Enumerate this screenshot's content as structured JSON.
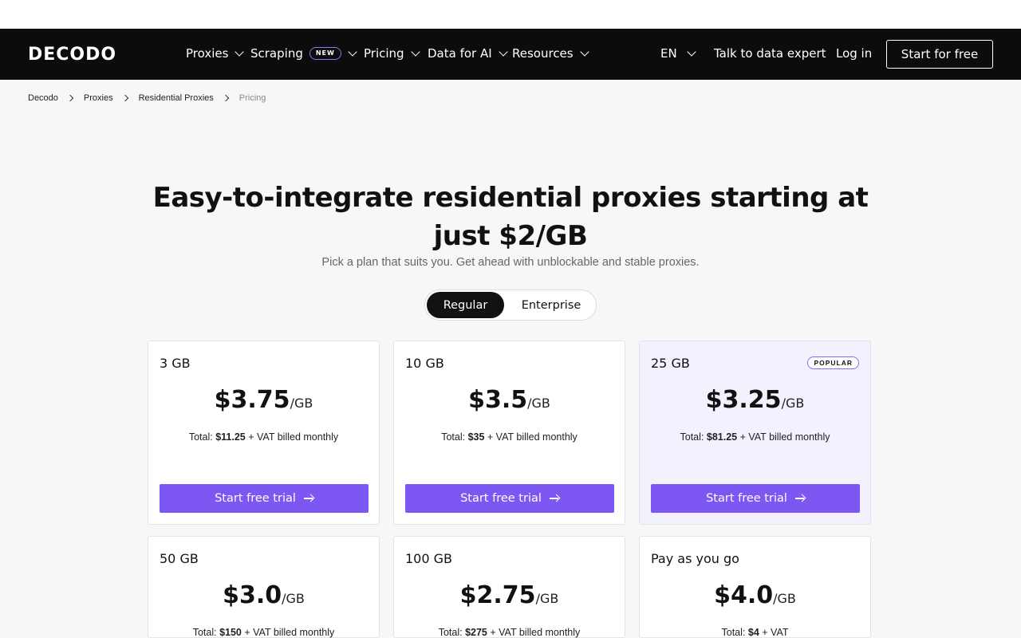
{
  "brand": {
    "logo": "DECODO",
    "accent": "#7c57f2",
    "nav_bg": "#0c0c0c"
  },
  "nav": {
    "items": [
      {
        "label": "Proxies"
      },
      {
        "label": "Scraping",
        "badge": "NEW"
      },
      {
        "label": "Pricing"
      },
      {
        "label": "Data for AI"
      },
      {
        "label": "Resources"
      }
    ],
    "language": "EN",
    "talk_label": "Talk to data expert",
    "login_label": "Log in",
    "start_label": "Start for free"
  },
  "breadcrumb": [
    "Decodo",
    "Proxies",
    "Residential Proxies",
    "Pricing"
  ],
  "hero": {
    "title": "Easy-to-integrate residential proxies starting at just $2/GB",
    "subtitle": "Pick a plan that suits you. Get ahead with unblockable and stable proxies."
  },
  "toggle": {
    "options": [
      "Regular",
      "Enterprise"
    ],
    "selected": "Regular"
  },
  "plans": [
    {
      "size": "3 GB",
      "price": "$3.75",
      "unit": "/GB",
      "total_prefix": "Total:",
      "total": "$11.25",
      "total_suffix": "+ VAT billed monthly",
      "cta": "Start free trial"
    },
    {
      "size": "10 GB",
      "price": "$3.5",
      "unit": "/GB",
      "total_prefix": "Total:",
      "total": "$35",
      "total_suffix": "+ VAT billed monthly",
      "cta": "Start free trial"
    },
    {
      "size": "25 GB",
      "price": "$3.25",
      "unit": "/GB",
      "total_prefix": "Total:",
      "total": "$81.25",
      "total_suffix": "+ VAT billed monthly",
      "cta": "Start free trial",
      "badge": "POPULAR"
    },
    {
      "size": "50 GB",
      "price": "$3.0",
      "unit": "/GB",
      "total_prefix": "Total:",
      "total": "$150",
      "total_suffix": "+ VAT billed monthly"
    },
    {
      "size": "100 GB",
      "price": "$2.75",
      "unit": "/GB",
      "total_prefix": "Total:",
      "total": "$275",
      "total_suffix": "+ VAT billed monthly"
    },
    {
      "size": "Pay as you go",
      "price": "$4.0",
      "unit": "/GB",
      "total_prefix": "Total:",
      "total": "$4",
      "total_suffix": "+ VAT"
    }
  ]
}
